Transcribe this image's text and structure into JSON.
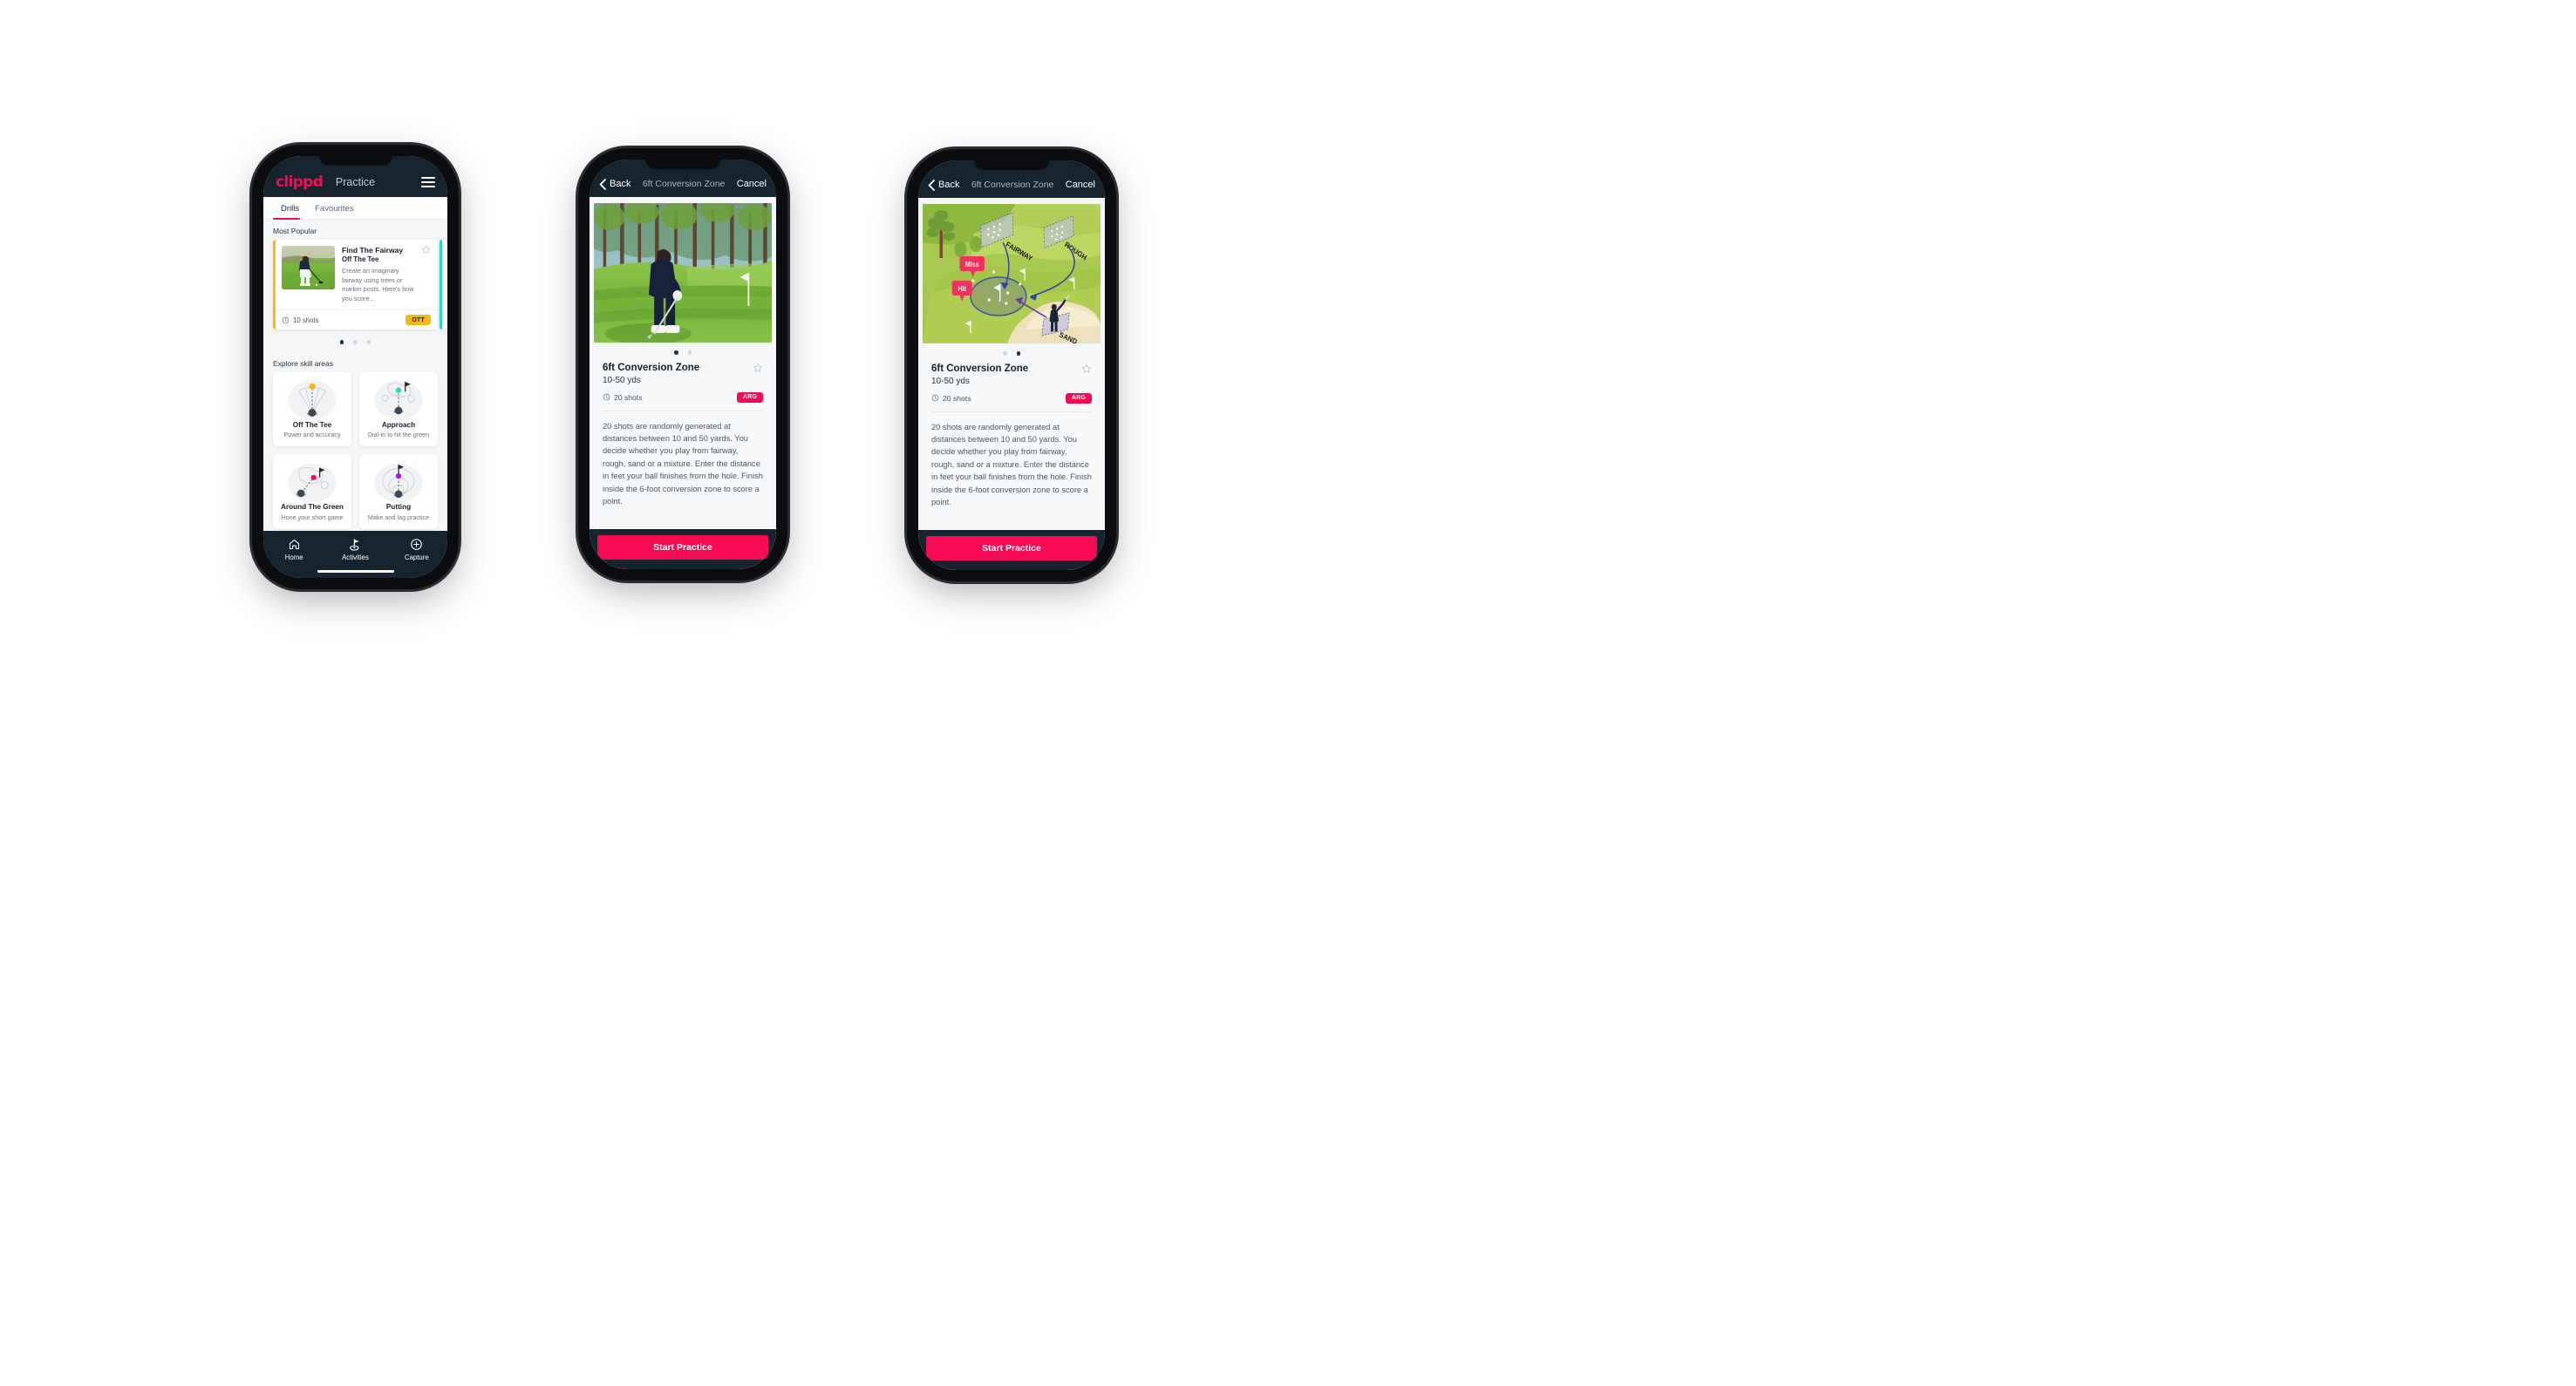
{
  "page": {
    "background": "#ffffff",
    "brand_color": "#f50a54",
    "nav_dark": "#16242f",
    "accent_yellow": "#f7b90f",
    "accent_teal": "#2fd6bb"
  },
  "phone1": {
    "header": {
      "brand": "clippd",
      "title": "Practice",
      "menu_icon": "hamburger-icon"
    },
    "tabs": [
      {
        "label": "Drills",
        "active": true
      },
      {
        "label": "Favourites",
        "active": false
      }
    ],
    "most_popular": {
      "section_label": "Most Popular",
      "card": {
        "title": "Find The Fairway",
        "subtitle": "Off The Tee",
        "description": "Create an imaginary fairway using trees or marker posts. Here's how you score...",
        "shots": "10 shots",
        "badge": "OTT",
        "badge_color": "#f7b90f",
        "stripe_color": "#f7b90f",
        "star_icon": "star-outline-icon",
        "clock_icon": "shots-clock-icon",
        "thumb_icon": "golfer-teeing-photo"
      },
      "peek_stripe_color": "#2fd6bb",
      "dots": [
        {
          "active": true
        },
        {
          "active": false
        },
        {
          "active": false
        }
      ]
    },
    "skill_areas": {
      "section_label": "Explore skill areas",
      "items": [
        {
          "name": "Off The Tee",
          "desc": "Power and accuracy",
          "icon": "tee-fan-icon",
          "dot_color": "#f7b90f"
        },
        {
          "name": "Approach",
          "desc": "Dial-in to hit the green",
          "icon": "approach-green-icon",
          "dot_color": "#2fd6bb"
        },
        {
          "name": "Around The Green",
          "desc": "Hone your short game",
          "icon": "around-green-icon",
          "dot_color": "#f50a54"
        },
        {
          "name": "Putting",
          "desc": "Make and lag practice",
          "icon": "putting-rings-icon",
          "dot_color": "#a617e0"
        }
      ]
    },
    "tabbar": [
      {
        "label": "Home",
        "icon": "home-icon",
        "active": false
      },
      {
        "label": "Activities",
        "icon": "golf-flag-icon",
        "active": true
      },
      {
        "label": "Capture",
        "icon": "plus-circle-icon",
        "active": false
      }
    ]
  },
  "phone2": {
    "nav": {
      "back_label": "Back",
      "back_icon": "chevron-left-icon",
      "title": "6ft Conversion Zone",
      "cancel_label": "Cancel"
    },
    "hero": {
      "media": "golfer-chipping-photo"
    },
    "dots": [
      {
        "active": true
      },
      {
        "active": false
      }
    ],
    "detail": {
      "title": "6ft Conversion Zone",
      "yardage": "10-50 yds",
      "shots": "20 shots",
      "badge": "ARG",
      "badge_color": "#f50a54",
      "star_icon": "star-outline-icon",
      "clock_icon": "shots-clock-icon",
      "description": "20 shots are randomly generated at distances between 10 and 50 yards. You decide whether you play from fairway, rough, sand or a mixture. Enter the distance in feet your ball finishes from the hole. Finish inside the 6-foot conversion zone to score a point."
    },
    "cta": {
      "label": "Start Practice",
      "color": "#f50a54"
    }
  },
  "phone3": {
    "nav": {
      "back_label": "Back",
      "back_icon": "chevron-left-icon",
      "title": "6ft Conversion Zone",
      "cancel_label": "Cancel"
    },
    "hero": {
      "media": "golf-course-diagram",
      "labels": {
        "fairway": "FAIRWAY",
        "rough": "ROUGH",
        "sand": "SAND",
        "miss": "Miss",
        "hit": "Hit"
      }
    },
    "dots": [
      {
        "active": false
      },
      {
        "active": true
      }
    ],
    "detail": {
      "title": "6ft Conversion Zone",
      "yardage": "10-50 yds",
      "shots": "20 shots",
      "badge": "ARG",
      "badge_color": "#f50a54",
      "star_icon": "star-outline-icon",
      "clock_icon": "shots-clock-icon",
      "description": "20 shots are randomly generated at distances between 10 and 50 yards. You decide whether you play from fairway, rough, sand or a mixture. Enter the distance in feet your ball finishes from the hole. Finish inside the 6-foot conversion zone to score a point."
    },
    "cta": {
      "label": "Start Practice",
      "color": "#f50a54"
    }
  }
}
